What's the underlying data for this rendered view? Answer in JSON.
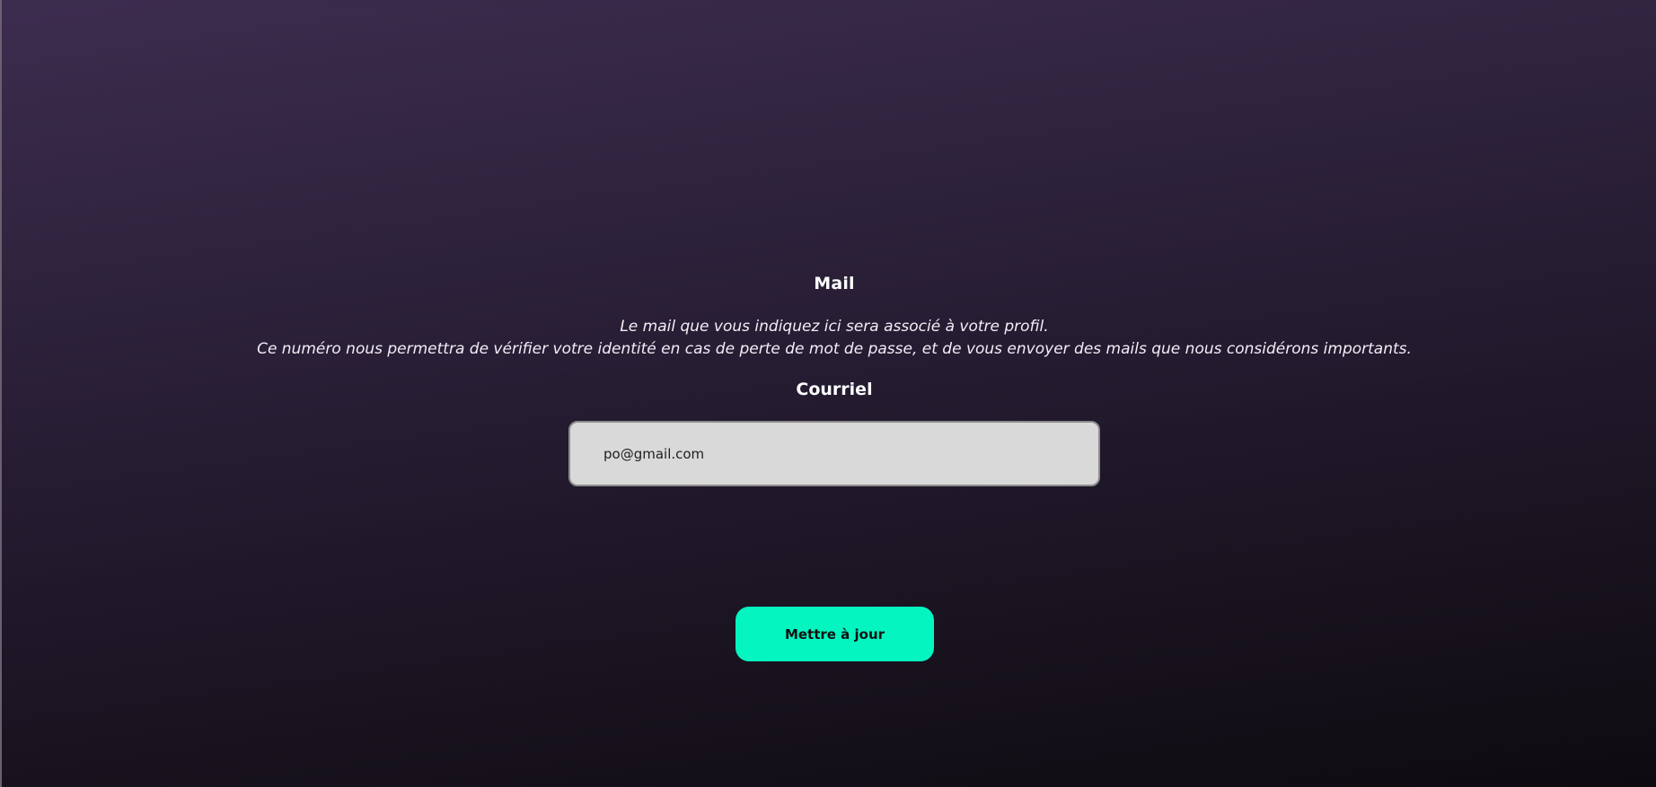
{
  "section": {
    "title": "Mail",
    "description_line1": "Le mail que vous indiquez ici sera associé à votre profil.",
    "description_line2": "Ce numéro nous permettra de vérifier votre identité en cas de perte de mot de passe, et de vous envoyer des mails que nous considérons importants."
  },
  "form": {
    "email_label": "Courriel",
    "email_value": "po@gmail.com",
    "submit_label": "Mettre à jour"
  },
  "colors": {
    "accent": "#05f5c0",
    "input_bg": "#d9d9d9"
  }
}
